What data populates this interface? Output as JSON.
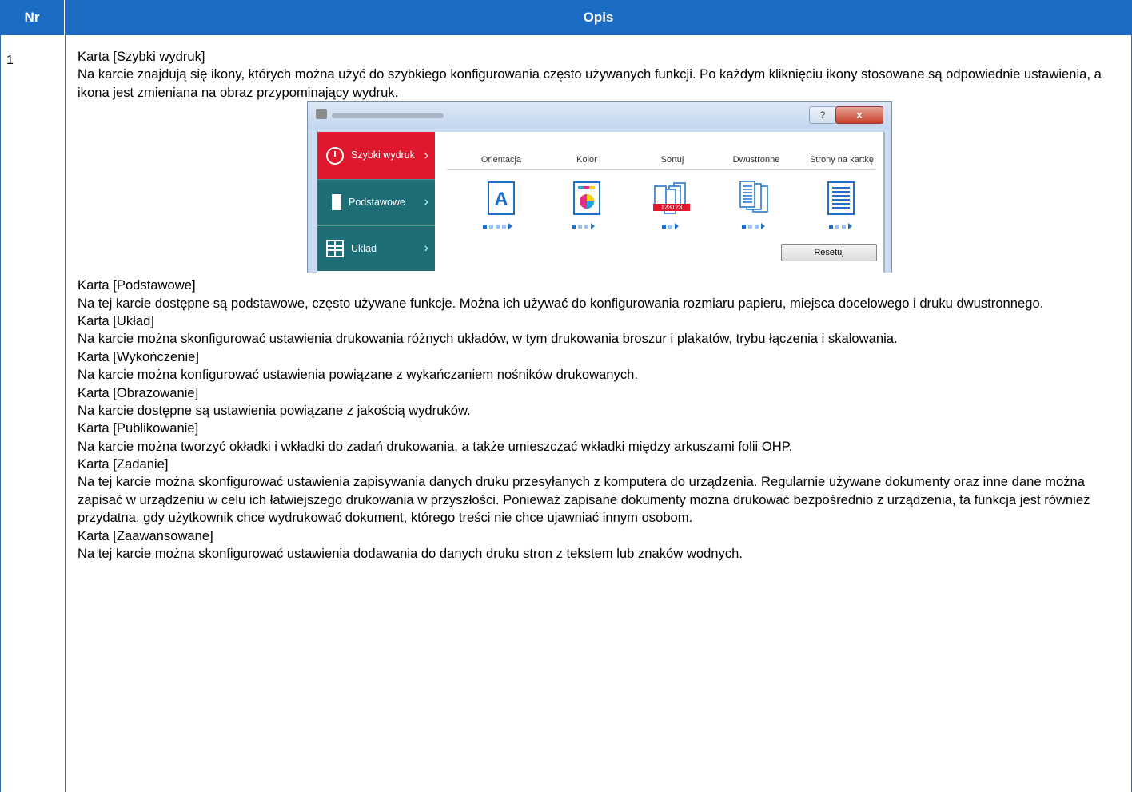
{
  "header": {
    "nr": "Nr",
    "opis": "Opis"
  },
  "row": {
    "nr": "1"
  },
  "sections": [
    {
      "title": "Karta [Szybki wydruk]",
      "desc": "Na karcie znajdują się ikony, których można użyć do szybkiego konfigurowania często używanych funkcji. Po każdym kliknięciu ikony stosowane są odpowiednie ustawienia, a ikona jest zmieniana na obraz przypominający wydruk."
    },
    {
      "title": "Karta [Podstawowe]",
      "desc": "Na tej karcie dostępne są podstawowe, często używane funkcje. Można ich używać do konfigurowania rozmiaru papieru, miejsca docelowego i druku dwustronnego."
    },
    {
      "title": "Karta [Układ]",
      "desc": "Na karcie można skonfigurować ustawienia drukowania różnych układów, w tym drukowania broszur i plakatów, trybu łączenia i skalowania."
    },
    {
      "title": "Karta [Wykończenie]",
      "desc": "Na karcie można konfigurować ustawienia powiązane z wykańczaniem nośników drukowanych."
    },
    {
      "title": "Karta [Obrazowanie]",
      "desc": "Na karcie dostępne są ustawienia powiązane z jakością wydruków."
    },
    {
      "title": "Karta [Publikowanie]",
      "desc": "Na karcie można tworzyć okładki i wkładki do zadań drukowania, a także umieszczać wkładki między arkuszami folii OHP."
    },
    {
      "title": "Karta [Zadanie]",
      "desc": "Na tej karcie można skonfigurować ustawienia zapisywania danych druku przesyłanych z komputera do urządzenia. Regularnie używane dokumenty oraz inne dane można zapisać w urządzeniu w celu ich łatwiejszego drukowania w przyszłości. Ponieważ zapisane dokumenty można drukować bezpośrednio z urządzenia, ta funkcja jest również przydatna, gdy użytkownik chce wydrukować dokument, którego treści nie chce ujawniać innym osobom."
    },
    {
      "title": "Karta [Zaawansowane]",
      "desc": "Na tej karcie można skonfigurować ustawienia dodawania do danych druku stron z tekstem lub znaków wodnych."
    }
  ],
  "dialog": {
    "help": "?",
    "close": "x",
    "tabs": [
      "Szybki wydruk",
      "Podstawowe",
      "Układ"
    ],
    "options": [
      "Orientacja",
      "Kolor",
      "Sortuj",
      "Dwustronne",
      "Strony na kartkę"
    ],
    "orientation_letter": "A",
    "reset": "Resetuj"
  },
  "colors": {
    "header": "#1c6cc4",
    "active_tab": "#e0182d",
    "tab": "#1e6e78"
  }
}
